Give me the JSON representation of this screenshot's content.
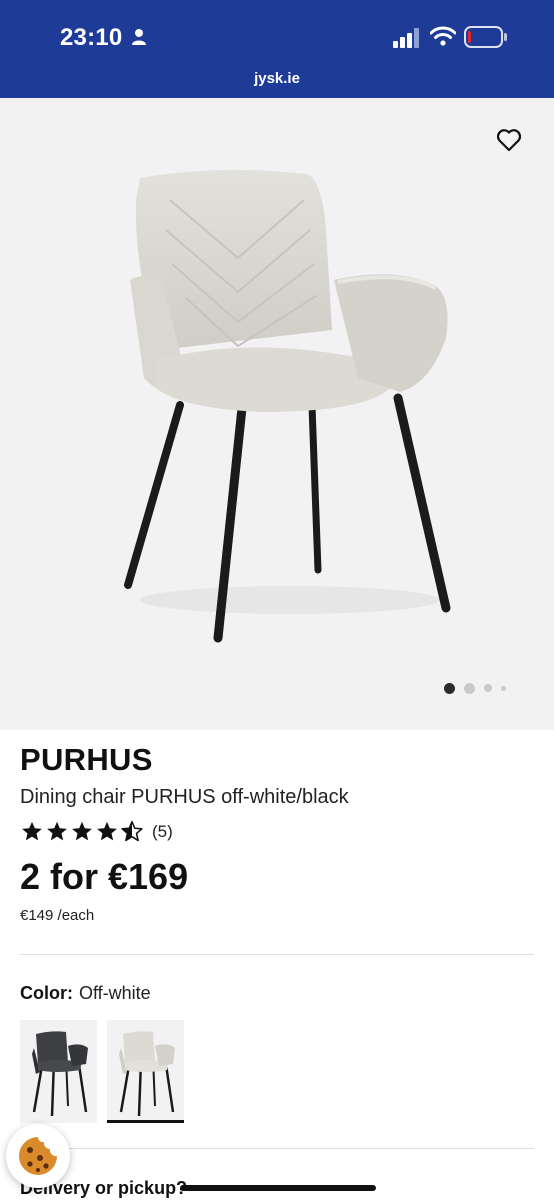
{
  "status_bar": {
    "time": "23:10",
    "icons": [
      "person-icon",
      "cellular-signal-icon",
      "wifi-icon",
      "battery-icon"
    ]
  },
  "browser": {
    "url": "jysk.ie"
  },
  "gallery": {
    "image": "chair-photo",
    "wishlist_icon": "heart-icon",
    "page_count": 4,
    "active_page": 1
  },
  "product": {
    "name": "PURHUS",
    "description": "Dining chair PURHUS off-white/black",
    "rating": 4.5,
    "rating_max": 5,
    "review_count": "(5)",
    "price": "2 for €169",
    "unit_price": "€149 /each"
  },
  "color": {
    "label": "Color:",
    "value": "Off-white",
    "swatches": [
      {
        "name": "dark-grey",
        "selected": false
      },
      {
        "name": "off-white",
        "selected": true
      }
    ]
  },
  "delivery": {
    "heading": "Delivery or pickup?"
  },
  "cookie": {
    "icon": "cookie-icon"
  },
  "colors": {
    "header_bg": "#1f3b98",
    "gallery_bg": "#f2f2f2",
    "text": "#111111",
    "battery_low": "#e3262b"
  }
}
